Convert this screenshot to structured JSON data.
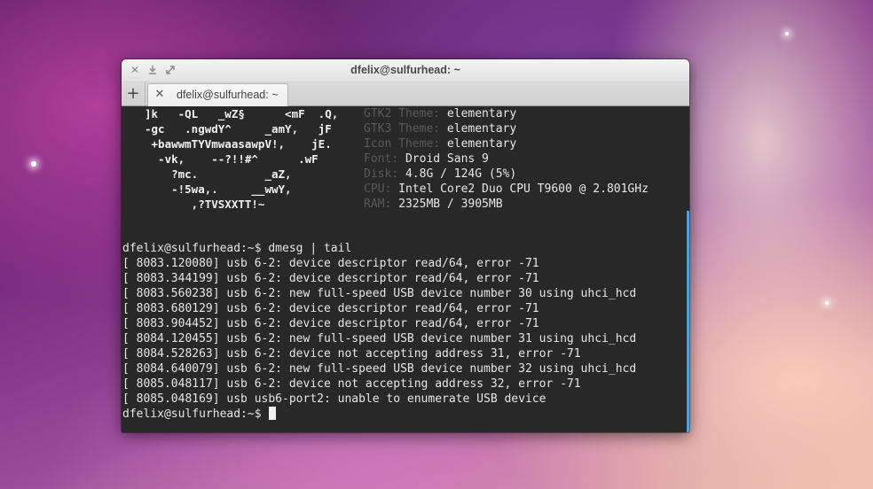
{
  "window": {
    "title": "dfelix@sulfurhead: ~",
    "titlebar_icons": [
      "close-icon",
      "minimize-icon",
      "maximize-icon"
    ]
  },
  "tabs": [
    {
      "label": "dfelix@sulfurhead: ~"
    }
  ],
  "terminal": {
    "logo_lines": [
      "]k   -QL   _wZ§      <mF  .Q,",
      "-gc   .ngwdY^     _amY,   jF",
      " +bawwmTYVmwaasawpV!,    jE.",
      "  -vk,    --?!!#^      .wF",
      "    ?mc.          _aZ,",
      "    -!5wa,.     __wwY,",
      "       ,?TVSXXTT!~"
    ],
    "sysinfo": [
      {
        "key": "GTK2 Theme:",
        "value": "elementary"
      },
      {
        "key": "GTK3 Theme:",
        "value": "elementary"
      },
      {
        "key": "Icon Theme:",
        "value": "elementary"
      },
      {
        "key": "Font:",
        "value": "Droid Sans 9"
      },
      {
        "key": "Disk:",
        "value": "4.8G / 124G (5%)"
      },
      {
        "key": "CPU:",
        "value": "Intel Core2 Duo CPU T9600 @ 2.801GHz"
      },
      {
        "key": "RAM:",
        "value": "2325MB / 3905MB"
      }
    ],
    "command_line": "dfelix@sulfurhead:~$ dmesg | tail",
    "output": [
      "[ 8083.120080] usb 6-2: device descriptor read/64, error -71",
      "[ 8083.344199] usb 6-2: device descriptor read/64, error -71",
      "[ 8083.560238] usb 6-2: new full-speed USB device number 30 using uhci_hcd",
      "[ 8083.680129] usb 6-2: device descriptor read/64, error -71",
      "[ 8083.904452] usb 6-2: device descriptor read/64, error -71",
      "[ 8084.120455] usb 6-2: new full-speed USB device number 31 using uhci_hcd",
      "[ 8084.528263] usb 6-2: device not accepting address 31, error -71",
      "[ 8084.640079] usb 6-2: new full-speed USB device number 32 using uhci_hcd",
      "[ 8085.048117] usb 6-2: device not accepting address 32, error -71",
      "[ 8085.048169] usb usb6-port2: unable to enumerate USB device"
    ],
    "prompt": "dfelix@sulfurhead:~$ "
  },
  "colors": {
    "terminal_bg": "#282828",
    "terminal_fg": "#e6e6e6",
    "dim_key": "#5a5a5a",
    "scroll_accent": "#4fa3d8"
  }
}
